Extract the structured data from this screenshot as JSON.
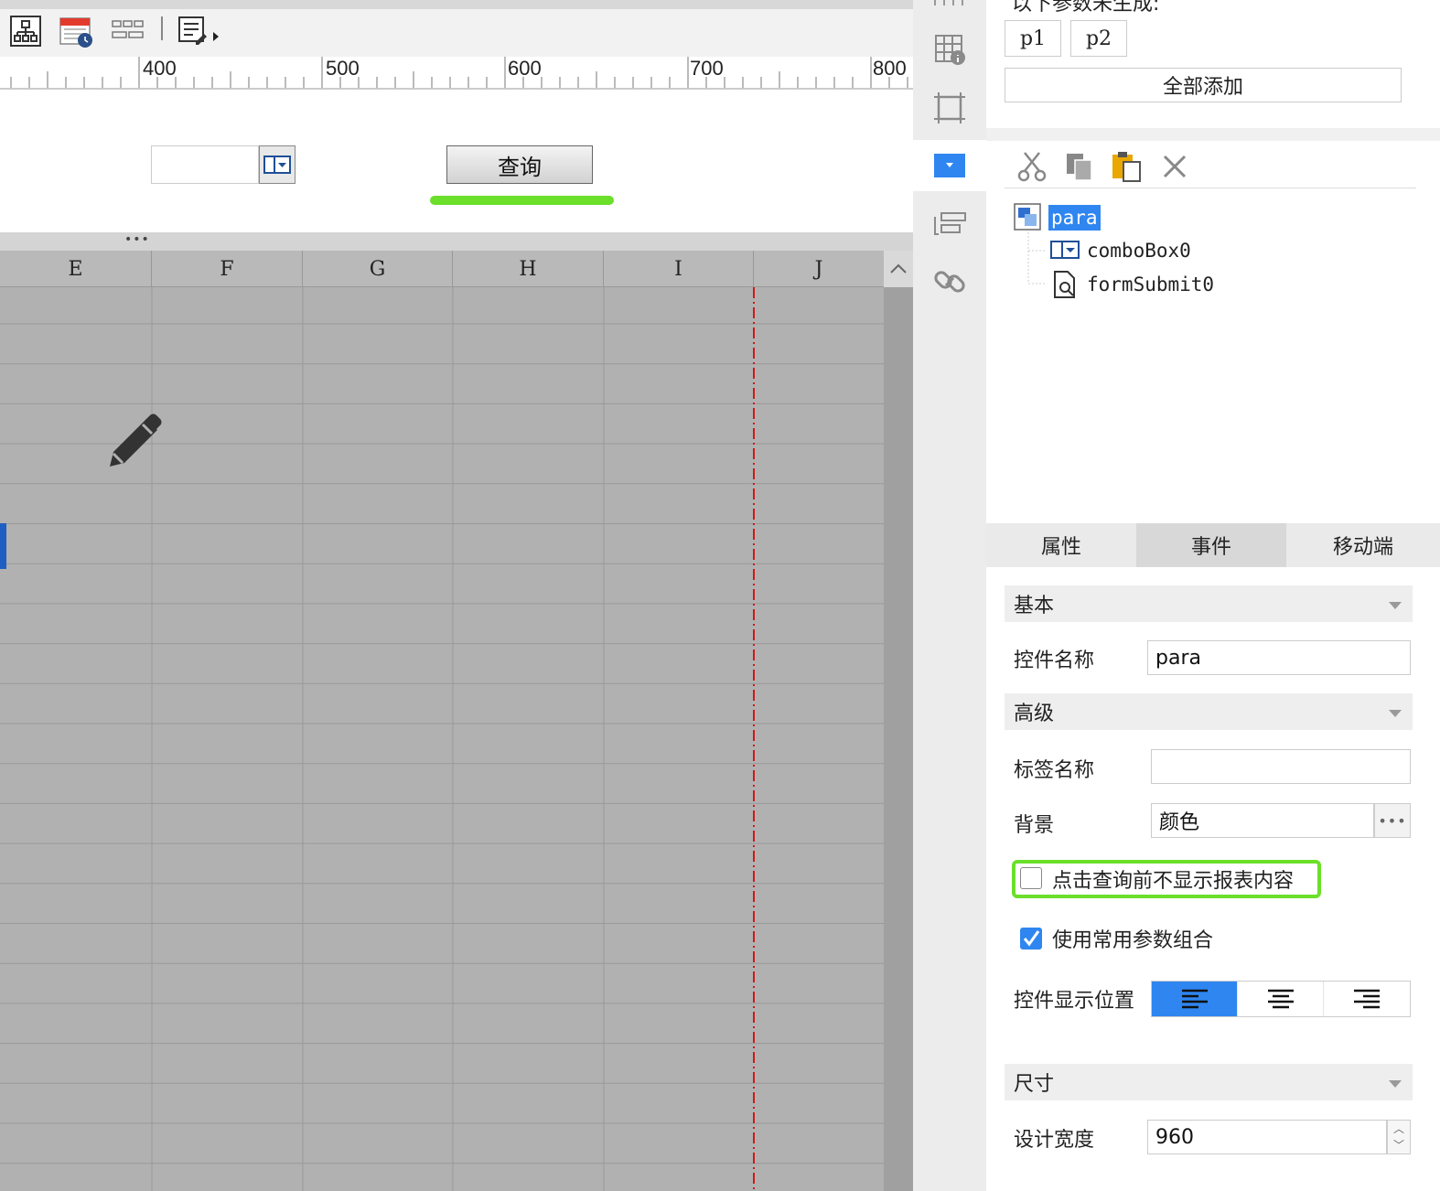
{
  "ruler": {
    "ticks": [
      "400",
      "500",
      "600",
      "700",
      "800"
    ]
  },
  "canvas": {
    "query_button_label": "查询"
  },
  "grid": {
    "columns": [
      "E",
      "F",
      "G",
      "H",
      "I",
      "J"
    ]
  },
  "params": {
    "partial_label": "以下参数未生成:",
    "items": [
      "p1",
      "p2"
    ],
    "add_all_label": "全部添加"
  },
  "tree": {
    "root": "para",
    "children": [
      "comboBox0",
      "formSubmit0"
    ]
  },
  "tabs": [
    "属性",
    "事件",
    "移动端"
  ],
  "props": {
    "section_basic": "基本",
    "widget_name_label": "控件名称",
    "widget_name_value": "para",
    "section_advanced": "高级",
    "tag_name_label": "标签名称",
    "tag_name_value": "",
    "background_label": "背景",
    "background_value": "颜色",
    "hide_before_query_label": "点击查询前不显示报表内容",
    "hide_before_query_checked": false,
    "use_common_params_label": "使用常用参数组合",
    "use_common_params_checked": true,
    "display_position_label": "控件显示位置",
    "display_position_selected": "left",
    "section_size": "尺寸",
    "design_width_label": "设计宽度",
    "design_width_value": "960"
  },
  "colors": {
    "accent": "#2f86f0",
    "highlight_green": "#6bdf2a",
    "red_boundary": "#d01818",
    "grid_bg": "#b1b1b1"
  }
}
